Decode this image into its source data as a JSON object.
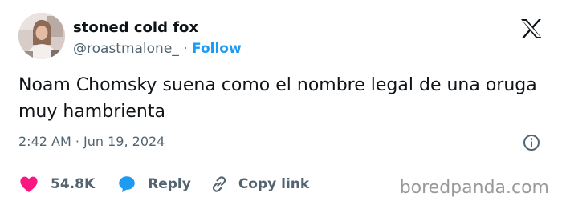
{
  "author": {
    "name": "stoned cold fox",
    "handle": "@roastmalone_",
    "separator": "·",
    "follow_label": "Follow"
  },
  "tweet": {
    "text": "Noam Chomsky suena como el nombre legal de una oruga muy hambrienta",
    "timestamp": "2:42 AM · Jun 19, 2024"
  },
  "actions": {
    "likes_count": "54.8K",
    "reply_label": "Reply",
    "copy_link_label": "Copy link"
  },
  "watermark": "boredpanda.com",
  "colors": {
    "accent": "#1d9bf0",
    "like": "#f91880",
    "text_primary": "#0f1419",
    "text_secondary": "#536471"
  },
  "icons": {
    "brand": "x-logo-icon",
    "info": "info-icon",
    "like": "heart-icon",
    "reply": "reply-bubble-icon",
    "copy": "link-icon"
  }
}
